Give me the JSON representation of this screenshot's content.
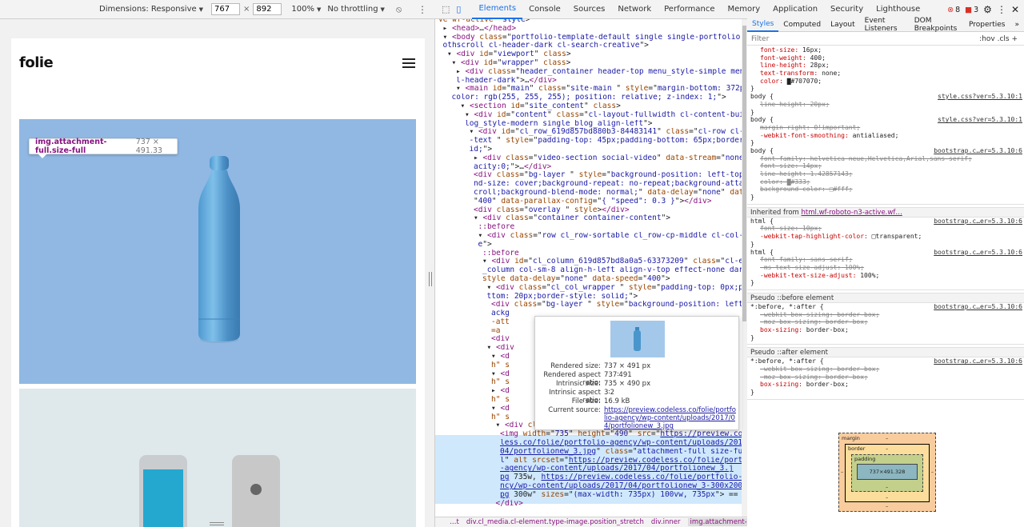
{
  "device_toolbar": {
    "dimensions_label": "Dimensions: Responsive",
    "width_value": "767",
    "times": "×",
    "height_value": "892",
    "zoom": "100%",
    "throttling": "No throttling"
  },
  "site": {
    "logo": "folie",
    "tooltip_selector": "img.attachment-full.size-full",
    "tooltip_dims": "737 × 491.33"
  },
  "devtools_tabs": [
    "Elements",
    "Console",
    "Sources",
    "Network",
    "Performance",
    "Memory",
    "Application",
    "Security",
    "Lighthouse"
  ],
  "status": {
    "errors": "8",
    "warnings": "3"
  },
  "dom_lines": [
    {
      "indent": 0,
      "html": "<span class='an'>ve wf-active</span>\" <span class='av'>style</span>&gt;"
    },
    {
      "indent": 1,
      "html": "▸ <span class='tag'>&lt;head&gt;</span>…<span class='tag'>&lt;/head&gt;</span>"
    },
    {
      "indent": 1,
      "html": "▾ <span class='tag'>&lt;body</span> <span class='an'>class</span>=\"<span class='av'>portfolio-template-default single single-portfolio postid-106 cl-smo</span>"
    },
    {
      "indent": 1,
      "html": "<span class='av'>othscroll cl-header-dark cl-search-creative</span>\"&gt;"
    },
    {
      "indent": 2,
      "html": "▾ <span class='tag'>&lt;div</span> <span class='an'>id</span>=\"<span class='av'>viewport</span>\" <span class='an'>class</span>&gt;"
    },
    {
      "indent": 3,
      "html": "▾ <span class='tag'>&lt;div</span> <span class='an'>id</span>=\"<span class='av'>wrapper</span>\" <span class='an'>class</span>&gt;"
    },
    {
      "indent": 4,
      "html": "▸ <span class='tag'>&lt;div</span> <span class='an'>class</span>=\"<span class='av'>header_container header-top menu_style-simple menu-full-style c</span>"
    },
    {
      "indent": 4,
      "html": "<span class='av'>l-header-dark</span>\"&gt;…<span class='tag'>&lt;/div&gt;</span>"
    },
    {
      "indent": 4,
      "html": "▾ <span class='tag'>&lt;main</span> <span class='an'>id</span>=\"<span class='av'>main</span>\" <span class='an'>class</span>=\"<span class='av'>site-main</span> \" <span class='an'>style</span>=\"<span class='av'>margin-bottom: 372px; background-</span>"
    },
    {
      "indent": 3,
      "html": "<span class='av'>color: rgb(255, 255, 255); position: relative; z-index: 1;</span>\"&gt;"
    },
    {
      "indent": 5,
      "html": "▾ <span class='tag'>&lt;section</span> <span class='an'>id</span>=\"<span class='av'>site_content</span>\" <span class='an'>class</span>&gt;"
    },
    {
      "indent": 6,
      "html": "▾ <span class='tag'>&lt;div</span> <span class='an'>id</span>=\"<span class='av'>content</span>\" <span class='an'>class</span>=\"<span class='av'>cl-layout-fullwidth cl-content-builder single_b</span>"
    },
    {
      "indent": 6,
      "html": "<span class='av'>log_style-modern single_blog_align-left</span>\"&gt;"
    },
    {
      "indent": 7,
      "html": "▾ <span class='tag'>&lt;div</span> <span class='an'>id</span>=\"<span class='av'>cl_row_619d857bd880b3-84483141</span>\" <span class='an'>class</span>=\"<span class='av'>cl-row cl-element dark</span>"
    },
    {
      "indent": 7,
      "html": "<span class='av'>-text</span> \" <span class='an'>style</span>=\"<span class='av'>padding-top: 45px;padding-bottom: 65px;border-style: sol</span>"
    },
    {
      "indent": 7,
      "html": "<span class='av'>id;</span>\"&gt;"
    },
    {
      "indent": 8,
      "html": "▸ <span class='tag'>&lt;div</span> <span class='an'>class</span>=\"<span class='av'>video-section social-video</span>\" <span class='an'>data-stream</span>=\"<span class='av'>none</span>\" <span class='an'>style</span>=\"<span class='av'>op</span>"
    },
    {
      "indent": 8,
      "html": "<span class='av'>acity:0;</span>\"&gt;…<span class='tag'>&lt;/div&gt;</span>"
    },
    {
      "indent": 8,
      "html": "<span class='tag'>&lt;div</span> <span class='an'>class</span>=\"<span class='av'>bg-layer</span> \" <span class='an'>style</span>=\"<span class='av'>background-position: left-top;backgrou</span>"
    },
    {
      "indent": 8,
      "html": "<span class='av'>nd-size: cover;background-repeat: no-repeat;background-attachment: s</span>"
    },
    {
      "indent": 8,
      "html": "<span class='av'>croll;background-blend-mode: normal;</span>\" <span class='an'>data-delay</span>=\"<span class='av'>none</span>\" <span class='an'>data-speed</span>="
    },
    {
      "indent": 8,
      "html": "\"<span class='av'>400</span>\" <span class='an'>data-parallax-config</span>=\"<span class='av'>{ \"speed\": 0.3 }</span>\"&gt;<span class='tag'>&lt;/div&gt;</span>"
    },
    {
      "indent": 8,
      "html": "<span class='tag'>&lt;div</span> <span class='an'>class</span>=\"<span class='av'>overlay</span> \" <span class='an'>style</span>&gt;<span class='tag'>&lt;/div&gt;</span>"
    },
    {
      "indent": 8,
      "html": "▾ <span class='tag'>&lt;div</span> <span class='an'>class</span>=\"<span class='av'>container container-content</span>\"&gt;"
    },
    {
      "indent": 9,
      "html": "<span class='pseudo'>::before</span>"
    },
    {
      "indent": 9,
      "html": "▾ <span class='tag'>&lt;div</span> <span class='an'>class</span>=\"<span class='av'>row cl_row-sortable cl_row-cp-middle cl-col-tablet-none</span>"
    },
    {
      "indent": 9,
      "html": "<span class='av'>e</span>\"&gt;"
    },
    {
      "indent": 10,
      "html": "<span class='pseudo'>::before</span>"
    },
    {
      "indent": 10,
      "html": "▾ <span class='tag'>&lt;div</span> <span class='an'>id</span>=\"<span class='av'>cl_column_619d857bd8a0a5-63373209</span>\" <span class='an'>class</span>=\"<span class='av'>cl-element cl</span>"
    },
    {
      "indent": 10,
      "html": "<span class='av'>_column col-sm-8  align-h-left align-v-top effect-none dark-text</span>\""
    },
    {
      "indent": 10,
      "html": "<span class='an'>style data-delay</span>=\"<span class='av'>none</span>\" <span class='an'>data-speed</span>=\"<span class='av'>400</span>\"&gt;"
    },
    {
      "indent": 11,
      "html": "▾ <span class='tag'>&lt;div</span> <span class='an'>class</span>=\"<span class='av'>cl_col_wrapper</span> \" <span class='an'>style</span>=\"<span class='av'>padding-top: 0px;padding-bo</span>"
    },
    {
      "indent": 11,
      "html": "<span class='av'>ttom: 20px;border-style: solid;</span>\"&gt;"
    },
    {
      "indent": 12,
      "html": "<span class='tag'>&lt;div</span> <span class='an'>class</span>=\"<span class='av'>bg-layer</span> \" <span class='an'>style</span>=\"<span class='av'>background-position: left-top;b</span>"
    },
    {
      "indent": 12,
      "html": "<span class='av'>ackg</span>"
    },
    {
      "indent": 12,
      "html": "<span class='an'>-att</span>"
    },
    {
      "indent": 12,
      "html": "<span class='an'>=a</span>"
    },
    {
      "indent": 12,
      "html": "<span class='tag'>&lt;div</span>"
    },
    {
      "indent": 11,
      "html": "▾ <span class='tag'>&lt;div</span>"
    },
    {
      "indent": 12,
      "html": "▾ <span class='tag'>&lt;d</span>"
    },
    {
      "indent": 12,
      "html": "<span class='an'>h\"</span> <span class='an'>s</span>"
    },
    {
      "indent": 12,
      "html": "▾ <span class='tag'>&lt;d</span>"
    },
    {
      "indent": 12,
      "html": "<span class='an'>h\"</span> <span class='an'>s</span>"
    },
    {
      "indent": 12,
      "html": "▸ <span class='tag'>&lt;d</span>"
    },
    {
      "indent": 12,
      "html": "<span class='an'>h\"</span> <span class='an'>s</span>"
    },
    {
      "indent": 12,
      "html": "▾ <span class='tag'>&lt;d</span>"
    },
    {
      "indent": 12,
      "html": "<span class='an'>h\"</span> <span class='an'>s</span>"
    },
    {
      "indent": 13,
      "html": "▾ <span class='tag'>&lt;div</span> <span class='an'>class</span>=\"<span class='av'>inner</span>\" <span class='an'>style</span>&gt;"
    },
    {
      "indent": 14,
      "html": "<span class='tag'>&lt;img</span> <span class='an'>width</span>=\"<span class='av'>735</span>\" <span class='an'>height</span>=\"<span class='av'>490</span>\" <span class='an'>src</span>=\"<span class='lnk'>https://preview.code</span>"
    },
    {
      "indent": 14,
      "html": "<span class='lnk'>less.co/folie/portfolio-agency/wp-content/uploads/2017/</span>"
    },
    {
      "indent": 14,
      "html": "<span class='lnk'>04/portfolionew_3.jpg</span>\" <span class='an'>class</span>=\"<span class='av'>attachment-full size-ful</span>"
    },
    {
      "indent": 14,
      "html": "<span class='av'>l</span>\" <span class='an'>alt</span> <span class='an'>srcset</span>=\"<span class='lnk'>https://preview.codeless.co/folie/portfolio</span>"
    },
    {
      "indent": 14,
      "html": "<span class='lnk'>-agency/wp-content/uploads/2017/04/portfolionew_3.j</span>"
    },
    {
      "indent": 14,
      "html": "<span class='lnk'>pg</span> 735w, <span class='lnk'>https://preview.codeless.co/folie/portfolio-age</span>"
    },
    {
      "indent": 14,
      "html": "<span class='lnk'>ncy/wp-content/uploads/2017/04/portfolionew_3-300x200.j</span>"
    },
    {
      "indent": 14,
      "html": "<span class='lnk'>pg</span> 300w\" <span class='an'>sizes</span>=\"<span class='av'>(max-width: 735px) 100vw, 735px</span>\"&gt; == <i>$0</i>"
    },
    {
      "indent": 13,
      "html": "<span class='tag'>&lt;/div&gt;</span>"
    }
  ],
  "image_popover": {
    "rendered_size_label": "Rendered size:",
    "rendered_size": "737 × 491 px",
    "rendered_aspect_label": "Rendered aspect ratio:",
    "rendered_aspect": "737∶491",
    "intrinsic_size_label": "Intrinsic size:",
    "intrinsic_size": "735 × 490 px",
    "intrinsic_aspect_label": "Intrinsic aspect ratio:",
    "intrinsic_aspect": "3∶2",
    "file_size_label": "File size:",
    "file_size": "16.9 kB",
    "current_source_label": "Current source:",
    "current_source": "https://preview.codeless.co/folie/portfolio-agency/wp-content/uploads/2017/04/portfolionew_3.jpg"
  },
  "breadcrumbs": [
    "…t",
    "div.cl_media.cl-element.type-image.position_stretch",
    "div.inner",
    "img.attachment-full.size-full"
  ],
  "styles_tabs": [
    "Styles",
    "Computed",
    "Layout",
    "Event Listeners",
    "DOM Breakpoints",
    "Properties"
  ],
  "filter": {
    "placeholder": "Filter",
    "tools": ":hov  .cls  +"
  },
  "inherited_header": "Inherited from ",
  "inherited_link": "html.wf-roboto-n3-active.wf…",
  "pseudo_before": "Pseudo ::before element",
  "pseudo_after": "Pseudo ::after element",
  "style_rules": [
    {
      "kind": "decl",
      "text": "font-size: 16px;"
    },
    {
      "kind": "decl",
      "text": "font-weight: 400;"
    },
    {
      "kind": "decl",
      "text": "line-height: 28px;"
    },
    {
      "kind": "decl",
      "text": "text-transform: none;"
    },
    {
      "kind": "decl",
      "text": "color: ▇#707070;"
    },
    {
      "kind": "close",
      "text": "}"
    },
    {
      "kind": "sel",
      "text": "body {",
      "src": "style.css?ver=5.3.10:1"
    },
    {
      "kind": "strike",
      "text": "line-height: 20px;"
    },
    {
      "kind": "close",
      "text": "}"
    },
    {
      "kind": "sel",
      "text": "body {",
      "src": "style.css?ver=5.3.10:1"
    },
    {
      "kind": "strike",
      "text": "margin-right: 0!important;"
    },
    {
      "kind": "decl",
      "text": "-webkit-font-smoothing: antialiased;"
    },
    {
      "kind": "close",
      "text": "}"
    },
    {
      "kind": "sel",
      "text": "body {",
      "src": "bootstrap.c…er=5.3.10:6"
    },
    {
      "kind": "strike",
      "text": "font-family: helvetica neue,Helvetica,Arial,sans-serif;"
    },
    {
      "kind": "strike",
      "text": "font-size: 14px;"
    },
    {
      "kind": "strike",
      "text": "line-height: 1.42857143;"
    },
    {
      "kind": "strike",
      "text": "color: ▇#333;"
    },
    {
      "kind": "strike",
      "text": "background-color: □#fff;"
    },
    {
      "kind": "close",
      "text": "}"
    }
  ],
  "style_rules_2": [
    {
      "kind": "sel",
      "text": "html {",
      "src": "bootstrap.c…er=5.3.10:6"
    },
    {
      "kind": "strike",
      "text": "font-size: 10px;"
    },
    {
      "kind": "decl",
      "text": "-webkit-tap-highlight-color: □transparent;"
    },
    {
      "kind": "close",
      "text": "}"
    },
    {
      "kind": "sel",
      "text": "html {",
      "src": "bootstrap.c…er=5.3.10:6"
    },
    {
      "kind": "strike",
      "text": "font-family: sans-serif;"
    },
    {
      "kind": "strike",
      "text": "-ms-text-size-adjust: 100%;"
    },
    {
      "kind": "decl",
      "text": "-webkit-text-size-adjust: 100%;"
    },
    {
      "kind": "close",
      "text": "}"
    }
  ],
  "style_rules_3": [
    {
      "kind": "sel",
      "text": "*:before, *:after {",
      "src": "bootstrap.c…er=5.3.10:6"
    },
    {
      "kind": "strike",
      "text": "-webkit-box-sizing: border-box;"
    },
    {
      "kind": "strike",
      "text": "-moz-box-sizing: border-box;"
    },
    {
      "kind": "decl",
      "text": "box-sizing: border-box;"
    },
    {
      "kind": "close",
      "text": "}"
    }
  ],
  "style_rules_4": [
    {
      "kind": "sel",
      "text": "*:before, *:after {",
      "src": "bootstrap.c…er=5.3.10:6"
    },
    {
      "kind": "strike",
      "text": "-webkit-box-sizing: border-box;"
    },
    {
      "kind": "strike",
      "text": "-moz-box-sizing: border-box;"
    },
    {
      "kind": "decl",
      "text": "box-sizing: border-box;"
    },
    {
      "kind": "close",
      "text": "}"
    }
  ],
  "box_model": {
    "margin": "margin",
    "border": "border",
    "padding": "padding",
    "content": "737×491.328",
    "dash": "–"
  }
}
